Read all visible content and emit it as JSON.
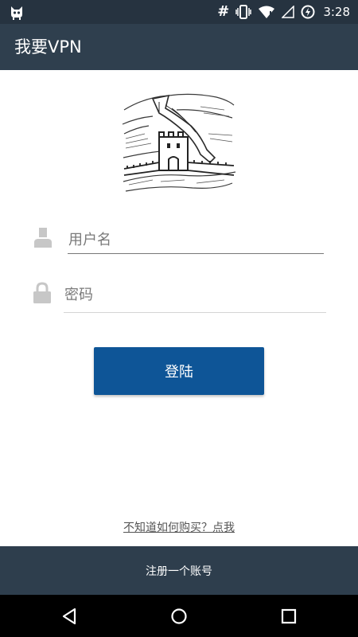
{
  "status_bar": {
    "time": "3:28",
    "hash_symbol": "#",
    "icons": [
      "cat-notification-icon",
      "vibrate-icon",
      "wifi-icon",
      "signal-icon",
      "battery-icon"
    ]
  },
  "app_bar": {
    "title": "我要VPN"
  },
  "logo": {
    "name": "great-wall-logo"
  },
  "form": {
    "username_placeholder": "用户名",
    "password_placeholder": "密码",
    "login_label": "登陆"
  },
  "buy_link": "不知道如何购买？点我",
  "register_label": "注册一个账号",
  "colors": {
    "status_bar": "#263340",
    "app_bar": "#2f3f4e",
    "primary_button": "#0e5597",
    "register_bar": "#2e3e4d"
  },
  "nav_bar": {
    "icons": [
      "back-icon",
      "home-icon",
      "recents-icon"
    ]
  }
}
